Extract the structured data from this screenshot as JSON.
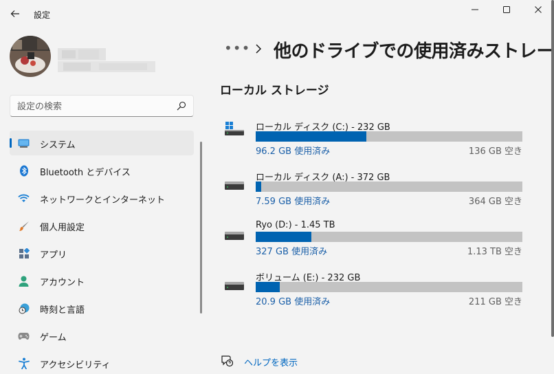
{
  "app": {
    "title": "設定"
  },
  "search": {
    "placeholder": "設定の検索"
  },
  "nav": {
    "items": [
      {
        "label": "システム",
        "icon": "system-icon",
        "active": true
      },
      {
        "label": "Bluetooth とデバイス",
        "icon": "bluetooth-icon"
      },
      {
        "label": "ネットワークとインターネット",
        "icon": "wifi-icon"
      },
      {
        "label": "個人用設定",
        "icon": "brush-icon"
      },
      {
        "label": "アプリ",
        "icon": "apps-icon"
      },
      {
        "label": "アカウント",
        "icon": "person-icon"
      },
      {
        "label": "時刻と言語",
        "icon": "clock-globe-icon"
      },
      {
        "label": "ゲーム",
        "icon": "gamepad-icon"
      },
      {
        "label": "アクセシビリティ",
        "icon": "accessibility-icon"
      }
    ]
  },
  "breadcrumb": {
    "more": "•••",
    "title": "他のドライブでの使用済みストレージ"
  },
  "section": {
    "title": "ローカル ストレージ"
  },
  "drives": [
    {
      "name": "ローカル ディスク (C:) - 232 GB",
      "used": "96.2 GB 使用済み",
      "free": "136 GB 空き",
      "used_fraction": 0.415,
      "icon": "windows-drive-icon"
    },
    {
      "name": "ローカル ディスク (A:) - 372 GB",
      "used": "7.59 GB 使用済み",
      "free": "364 GB 空き",
      "used_fraction": 0.02,
      "icon": "drive-icon"
    },
    {
      "name": "Ryo (D:) - 1.45 TB",
      "used": "327 GB 使用済み",
      "free": "1.13 TB 空き",
      "used_fraction": 0.21,
      "icon": "drive-icon"
    },
    {
      "name": "ボリューム (E:) - 232 GB",
      "used": "20.9 GB 使用済み",
      "free": "211 GB 空き",
      "used_fraction": 0.09,
      "icon": "drive-icon"
    }
  ],
  "help": {
    "label": "ヘルプを表示"
  },
  "colors": {
    "accent": "#0067c0",
    "bar_fill": "#0063b1",
    "bar_track": "#c3c3c3",
    "background": "#f3f3f3"
  }
}
